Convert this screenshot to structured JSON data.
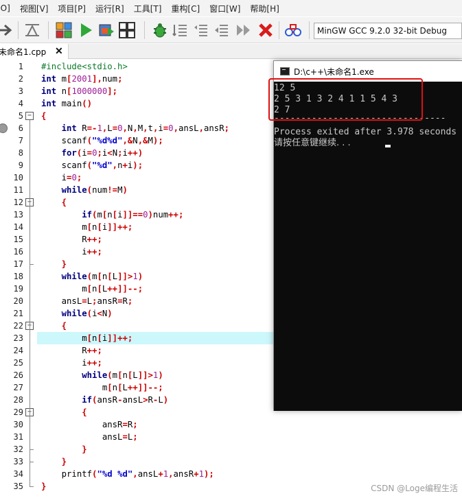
{
  "menu": {
    "items": [
      "[O]",
      "视图[V]",
      "项目[P]",
      "运行[R]",
      "工具[T]",
      "重构[C]",
      "窗口[W]",
      "帮助[H]"
    ]
  },
  "toolbar": {
    "compiler": "MinGW GCC 9.2.0 32-bit Debug",
    "icons": [
      "arrow-right-icon",
      "format-icon",
      "grid-icon",
      "run-icon",
      "compile-run-icon",
      "windows-icon",
      "debug-bug-icon",
      "indent-icon",
      "unindent-icon",
      "comment-icon",
      "fast-forward-icon",
      "stop-icon",
      "profile-icon"
    ]
  },
  "tab": {
    "label": "未命名1.cpp",
    "close": "✕"
  },
  "editor": {
    "line_numbers": [
      "1",
      "2",
      "3",
      "4",
      "5",
      "6",
      "7",
      "8",
      "9",
      "10",
      "11",
      "12",
      "13",
      "14",
      "15",
      "16",
      "17",
      "18",
      "19",
      "20",
      "21",
      "22",
      "23",
      "24",
      "25",
      "26",
      "27",
      "28",
      "29",
      "30",
      "31",
      "32",
      "33",
      "34",
      "35"
    ],
    "highlighted_line": 23,
    "breakpoint_line": 6
  },
  "console": {
    "title": "D:\\c++\\未命名1.exe",
    "lines": [
      "12 5",
      "2 5 3 1 3 2 4 1 1 5 4 3",
      "2 7",
      "--------------------------------",
      "Process exited after 3.978 seconds",
      "请按任意键继续. . ."
    ]
  },
  "watermark": "CSDN @Loge编程生活",
  "colors": {
    "highlight": "#ccf7fb",
    "console_bg": "#0c0c0c",
    "red_box": "#e01010",
    "keyword": "#00007f",
    "operator": "#cc0000"
  }
}
